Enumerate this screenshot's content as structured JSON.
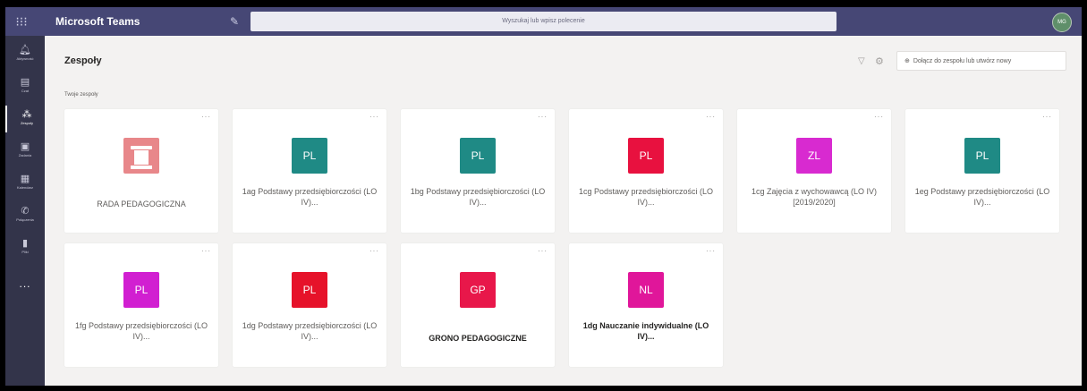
{
  "app": {
    "title": "Microsoft Teams",
    "search_placeholder": "Wyszukaj lub wpisz polecenie",
    "avatar_initials": "MG"
  },
  "rail": {
    "items": [
      {
        "label": "Aktywność",
        "icon": "bell-icon"
      },
      {
        "label": "Czat",
        "icon": "chat-icon"
      },
      {
        "label": "Zespoły",
        "icon": "teams-icon",
        "active": true
      },
      {
        "label": "Zadania",
        "icon": "assignments-icon"
      },
      {
        "label": "Kalendarz",
        "icon": "calendar-icon"
      },
      {
        "label": "Połączenia",
        "icon": "phone-icon"
      },
      {
        "label": "Pliki",
        "icon": "files-icon"
      }
    ],
    "more": "..."
  },
  "header": {
    "title": "Zespoły",
    "join_label": "Dołącz do zespołu lub utwórz nowy"
  },
  "section_label": "Twoje zespoły",
  "teams": [
    {
      "initials": "",
      "color": "#e8878a",
      "name": "RADA PEDAGOGICZNA",
      "logo": "column-logo"
    },
    {
      "initials": "PL",
      "color": "#1f8a85",
      "name": "1ag Podstawy przedsiębiorczości (LO IV)..."
    },
    {
      "initials": "PL",
      "color": "#1f8a85",
      "name": "1bg Podstawy przedsiębiorczości (LO IV)..."
    },
    {
      "initials": "PL",
      "color": "#e8113f",
      "name": "1cg Podstawy przedsiębiorczości (LO IV)..."
    },
    {
      "initials": "ZL",
      "color": "#d82ad0",
      "name": "1cg Zajęcia z wychowawcą (LO IV) [2019/2020]"
    },
    {
      "initials": "PL",
      "color": "#1f8a85",
      "name": "1eg Podstawy przedsiębiorczości (LO IV)..."
    },
    {
      "initials": "PL",
      "color": "#d11fd1",
      "name": "1fg Podstawy przedsiębiorczości (LO IV)..."
    },
    {
      "initials": "PL",
      "color": "#e6122a",
      "name": "1dg Podstawy przedsiębiorczości (LO IV)..."
    },
    {
      "initials": "GP",
      "color": "#e8174a",
      "name": "GRONO PEDAGOGICZNE"
    },
    {
      "initials": "NL",
      "color": "#e0169a",
      "name": "1dg Nauczanie indywidualne (LO IV)..."
    }
  ],
  "card_more": "···"
}
